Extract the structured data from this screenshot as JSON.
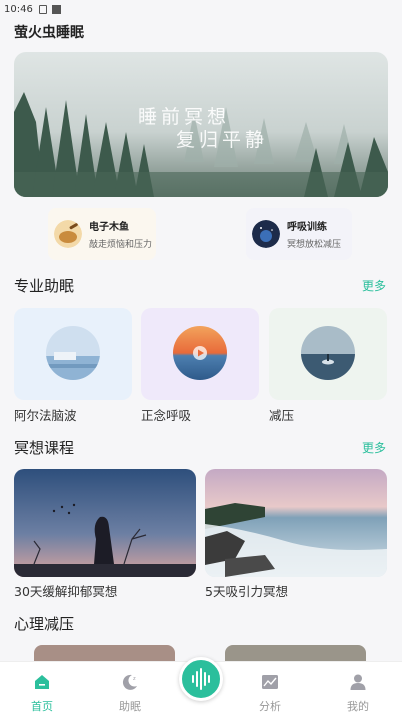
{
  "status_bar": {
    "time": "10:46"
  },
  "app": {
    "title": "萤火虫睡眠"
  },
  "hero": {
    "line1": "睡前冥想",
    "line2": "复归平静"
  },
  "quick_entries": [
    {
      "title": "电子木鱼",
      "subtitle": "敲走烦恼和压力",
      "icon": "wooden-fish-icon"
    },
    {
      "title": "呼吸训练",
      "subtitle": "冥想放松减压",
      "icon": "breath-icon"
    }
  ],
  "sections": {
    "pro": {
      "title": "专业助眠",
      "more": "更多"
    },
    "meditation": {
      "title": "冥想课程",
      "more": "更多"
    },
    "psychology": {
      "title": "心理减压"
    }
  },
  "pro_items": [
    {
      "label": "阿尔法脑波",
      "bg": "#e8f1fb"
    },
    {
      "label": "正念呼吸",
      "bg": "#efe9fa"
    },
    {
      "label": "减压",
      "bg": "#eef4ef"
    }
  ],
  "courses": [
    {
      "label": "30天缓解抑郁冥想"
    },
    {
      "label": "5天吸引力冥想"
    }
  ],
  "tabbar": {
    "items": [
      {
        "label": "首页",
        "icon": "home-icon",
        "active": true
      },
      {
        "label": "助眠",
        "icon": "moon-icon",
        "active": false
      },
      {
        "label": "分析",
        "icon": "chart-icon",
        "active": false
      },
      {
        "label": "我的",
        "icon": "profile-icon",
        "active": false
      }
    ],
    "center_icon": "sound-wave-icon"
  },
  "colors": {
    "accent": "#2bbf9c",
    "inactive": "#999999",
    "background": "#f6f6f8"
  }
}
